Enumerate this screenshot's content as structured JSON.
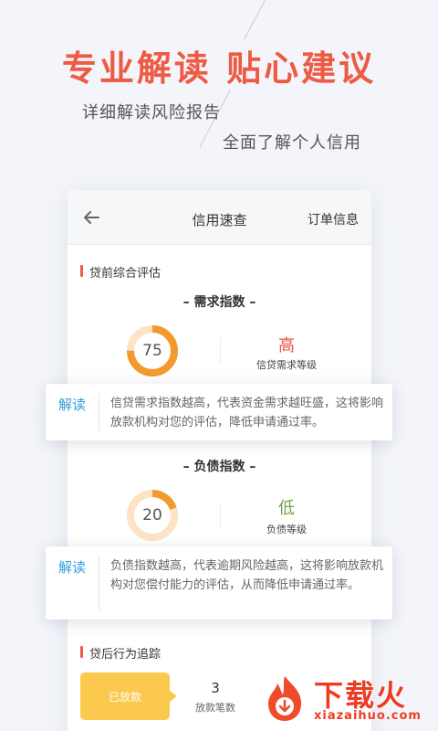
{
  "promo": {
    "headline": "专业解读  贴心建议",
    "subtitle_1": "详细解读风险报告",
    "subtitle_2": "全面了解个人信用"
  },
  "navbar": {
    "back_icon": "arrow-left-icon",
    "title": "信用速查",
    "right_action": "订单信息"
  },
  "pre_loan": {
    "section_title": "贷前综合评估",
    "demand": {
      "title": "– 需求指数 –",
      "score": "75",
      "score_fraction": 0.75,
      "level": "高",
      "level_caption": "信贷需求等级",
      "level_color": "#e8513f"
    },
    "debt": {
      "title": "– 负债指数 –",
      "score": "20",
      "score_fraction": 0.2,
      "level": "低",
      "level_caption": "负债等级",
      "level_color": "#6aa548"
    },
    "explain_tag": "解读",
    "demand_explain": "信贷需求指数越高，代表资金需求越旺盛，这将影响放款机构对您的评估，降低申请通过率。",
    "debt_explain": "负债指数越高，代表逾期风险越高，这将影响放款机构对您偿付能力的评估，从而降低申请通过率。"
  },
  "post_loan": {
    "section_title": "贷后行为追踪",
    "loaned_label": "已放款",
    "count": "3",
    "count_caption": "放款笔数"
  },
  "watermark": {
    "text": "下载火",
    "url": "xiazaihuo.com",
    "logo_icon": "flame-logo-icon"
  },
  "colors": {
    "accent": "#ee5a43",
    "ring_fill": "#f39a2e",
    "ring_track": "#fbe3c4",
    "explain_tag": "#2f9fd8",
    "loaned_button": "#fbc94e"
  }
}
